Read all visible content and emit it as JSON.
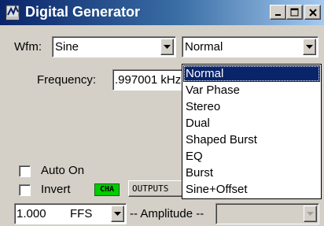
{
  "window": {
    "title": "Digital Generator",
    "controls": [
      "minimize-icon",
      "maximize-icon",
      "close-icon"
    ]
  },
  "waveform": {
    "label": "Wfm:",
    "value": "Sine",
    "mode_value": "Normal",
    "mode_options": [
      "Normal",
      "Var Phase",
      "Stereo",
      "Dual",
      "Shaped Burst",
      "EQ",
      "Burst",
      "Sine+Offset"
    ],
    "selected_index": 0
  },
  "frequency": {
    "label": "Frequency:",
    "value": ".997001 kHz"
  },
  "options": {
    "auto_on": "Auto On",
    "invert": "Invert"
  },
  "channel_badge": "CHA",
  "outputs_button": "OUTPUTS",
  "amplitude": {
    "value": "1.000",
    "unit": "FFS",
    "label": "-- Amplitude --"
  },
  "colors": {
    "titlebar_start": "#0a246a",
    "titlebar_end": "#a6caf0",
    "selection": "#0a246a",
    "channel_badge": "#00cc00",
    "face": "#d4d0c8"
  }
}
